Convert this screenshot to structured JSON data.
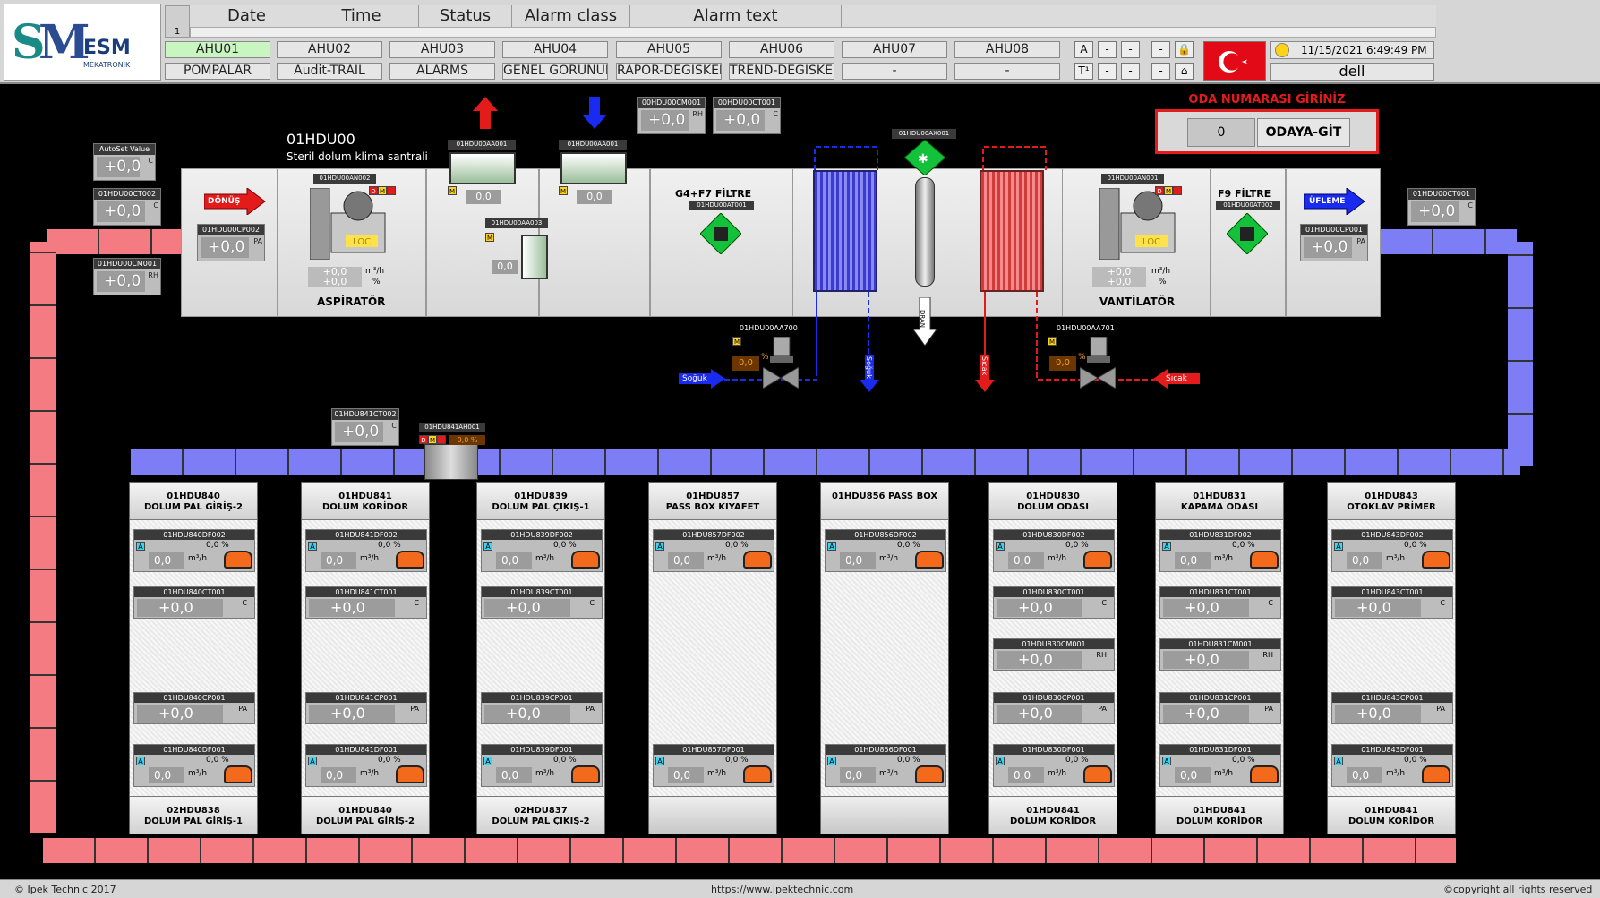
{
  "header": {
    "table_row": "1",
    "columns": [
      "Date",
      "Time",
      "Status",
      "Alarm class",
      "Alarm text"
    ],
    "nav_row1": [
      "AHU01",
      "AHU02",
      "AHU03",
      "AHU04",
      "AHU05",
      "AHU06",
      "AHU07",
      "AHU08"
    ],
    "nav_row2": [
      "POMPALAR",
      "Audit-TRAIL",
      "ALARMS",
      "GENEL GORUNUM",
      "RAPOR-DEGISKEN",
      "TREND-DEGISKEN",
      "-",
      "-"
    ],
    "small_btns": [
      "A",
      "-",
      "-",
      "-",
      "T¹",
      "-",
      "-",
      "-"
    ],
    "datetime": "11/15/2021 6:49:49 PM",
    "user": "dell",
    "logo_text": "ESM",
    "logo_sub": "MEKATRONIK"
  },
  "ahu": {
    "code": "01HDU00",
    "desc": "Steril dolum klima santrali",
    "dönüs": "DÖNÜŞ",
    "ufleme": "ÜFLEME",
    "aspirator": "ASPİRATÖR",
    "vantilator": "VANTİLATÖR",
    "g4f7": "G4+F7 FİLTRE",
    "f9": "F9 FİLTRE",
    "loc": "LOC",
    "soguk": "Soğuk",
    "sicak": "Sıcak",
    "dran": "DRAN",
    "oda_title": "ODA NUMARASI GİRİNİZ",
    "oda_btn": "ODAYA-GİT",
    "oda_val": "0"
  },
  "boxes": {
    "autoset": {
      "tag": "AutoSet Value",
      "val": "+0,0",
      "unit": "C"
    },
    "ct002": {
      "tag": "01HDU00CT002",
      "val": "+0,0",
      "unit": "C"
    },
    "cm001": {
      "tag": "01HDU00CM001",
      "val": "+0,0",
      "unit": "RH"
    },
    "cp002": {
      "tag": "01HDU00CP002",
      "val": "+0,0",
      "unit": "PA"
    },
    "cm001b": {
      "tag": "00HDU00CM001",
      "val": "+0,0",
      "unit": "RH"
    },
    "ct001b": {
      "tag": "00HDU00CT001",
      "val": "+0,0",
      "unit": "C"
    },
    "ct001r": {
      "tag": "01HDU00CT001",
      "val": "+0,0",
      "unit": "C"
    },
    "cp001": {
      "tag": "01HDU00CP001",
      "val": "+0,0",
      "unit": "PA"
    },
    "b841ct": {
      "tag": "01HDU841CT002",
      "val": "+0,0",
      "unit": "C"
    }
  },
  "tags": {
    "an002": "01HDU00AN002",
    "an001": "01HDU00AN001",
    "aa001": "01HDU00AA001",
    "aa001b": "01HDU00AA001",
    "aa003": "01HDU00AA003",
    "at001": "01HDU00AT001",
    "at002": "01HDU00AT002",
    "ax001": "01HDU00AX001",
    "aa700": "01HDU00AA700",
    "aa701": "01HDU00AA701",
    "ah001": "01HDU841AH001",
    "fan_m3": "+0,0",
    "fan_pct": "+0,0",
    "m3h": "m³/h",
    "pct": "%",
    "damper": "0,0",
    "valve": "0,0",
    "ah_pct": "0,0 %"
  },
  "rooms": [
    {
      "top1": "01HDU840",
      "top2": "DOLUM PAL GİRİŞ-2",
      "p": "840",
      "bot1": "02HDU838",
      "bot2": "DOLUM PAL GİRİŞ-1",
      "rh": false
    },
    {
      "top1": "01HDU841",
      "top2": "DOLUM KORİDOR",
      "p": "841",
      "bot1": "01HDU840",
      "bot2": "DOLUM PAL GİRİŞ-2",
      "rh": false
    },
    {
      "top1": "01HDU839",
      "top2": "DOLUM PAL ÇIKIŞ-1",
      "p": "839",
      "bot1": "02HDU837",
      "bot2": "DOLUM PAL ÇIKIŞ-2",
      "rh": false
    },
    {
      "top1": "01HDU857",
      "top2": "PASS BOX KIYAFET",
      "p": "857",
      "bot1": "",
      "bot2": "",
      "rh": false,
      "pass": true
    },
    {
      "top1": "01HDU856 PASS BOX",
      "top2": "",
      "p": "856",
      "bot1": "",
      "bot2": "",
      "rh": false,
      "pass": true
    },
    {
      "top1": "01HDU830",
      "top2": "DOLUM ODASI",
      "p": "830",
      "bot1": "01HDU841",
      "bot2": "DOLUM KORİDOR",
      "rh": true
    },
    {
      "top1": "01HDU831",
      "top2": "KAPAMA ODASI",
      "p": "831",
      "bot1": "01HDU841",
      "bot2": "DOLUM KORİDOR",
      "rh": true
    },
    {
      "top1": "01HDU843",
      "top2": "OTOKLAV PRİMER",
      "p": "843",
      "bot1": "01HDU841",
      "bot2": "DOLUM KORİDOR",
      "rh": false
    }
  ],
  "room_vals": {
    "flow": "0,0",
    "flow_unit": "m³/h",
    "flow_pct": "0,0 %",
    "val": "+0,0"
  },
  "footer": {
    "left": "© Ipek Technic 2017",
    "center": "https://www.ipektechnic.com",
    "right": "©copyright all rights reserved"
  }
}
